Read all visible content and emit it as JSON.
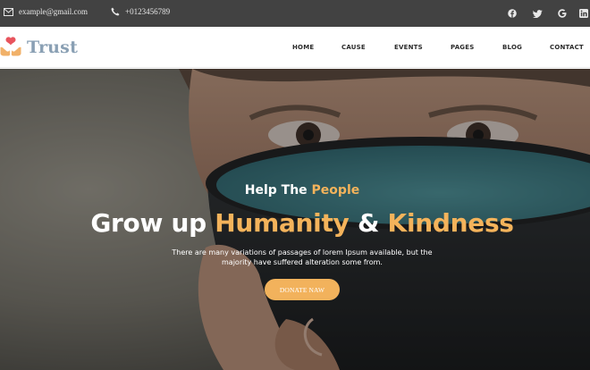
{
  "topbar": {
    "email": "example@gmail.com",
    "phone": "+0123456789",
    "social": [
      {
        "icon": "facebook-icon",
        "glyph": "f"
      },
      {
        "icon": "twitter-icon",
        "glyph": "t"
      },
      {
        "icon": "google-icon",
        "glyph": "G"
      },
      {
        "icon": "linkedin-icon",
        "glyph": "in"
      }
    ]
  },
  "logo": {
    "text": "Trust",
    "icon": "heart-hands-icon"
  },
  "nav": {
    "items": [
      "HOME",
      "CAUSE",
      "EVENTS",
      "PAGES",
      "BLOG",
      "CONTACT"
    ]
  },
  "hero": {
    "subtitle_prefix": "Help The",
    "subtitle_accent": "People",
    "headline_prefix": "Grow up",
    "headline_accent1": "Humanity",
    "headline_mid": "&",
    "headline_accent2": "Kindness",
    "description_line1": "There are many variations of passages of lorem Ipsum available, but the",
    "description_line2": "majority have suffered alteration some from.",
    "donate_label": "DONATE NAW"
  },
  "colors": {
    "topbar_bg": "#424242",
    "accent": "#f4b35b",
    "button": "#f2b25c",
    "logo_text": "#8aa0b4",
    "logo_heart": "#e8545d"
  }
}
